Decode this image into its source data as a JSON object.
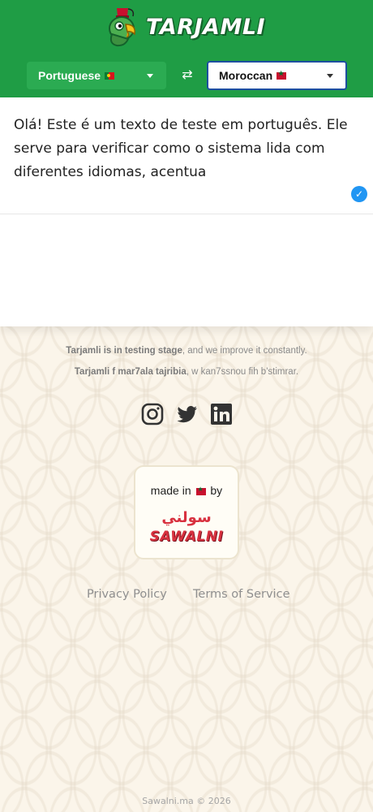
{
  "app": {
    "name": "TARJAMLI",
    "brand_color": "#1f9d45"
  },
  "languages": {
    "source": {
      "label": "Portuguese",
      "flag_icon": "portugal-flag-icon"
    },
    "target": {
      "label": "Moroccan",
      "flag_icon": "morocco-flag-icon"
    },
    "swap_icon": "swap-arrows-icon"
  },
  "translation": {
    "source_text": "Olá! Este é um texto de teste em português. Ele serve para verificar como o sistema lida com diferentes idiomas, acentua",
    "output_text": "",
    "status_icon": "check-icon"
  },
  "info": {
    "line1_bold": "Tarjamli is in testing stage",
    "line1_rest": ", and we improve it constantly.",
    "line2_bold": "Tarjamli f mar7ala tajribia",
    "line2_rest": ", w kan7ssnou fih b'stimrar."
  },
  "social": [
    "instagram-icon",
    "twitter-icon",
    "linkedin-icon"
  ],
  "made_in": {
    "prefix": "made in",
    "suffix": "by",
    "brand_ar": "سولني",
    "brand_en": "SAWALNI"
  },
  "footer": {
    "privacy": "Privacy Policy",
    "terms": "Terms of Service",
    "copyright": "Sawalni.ma © 2026"
  }
}
